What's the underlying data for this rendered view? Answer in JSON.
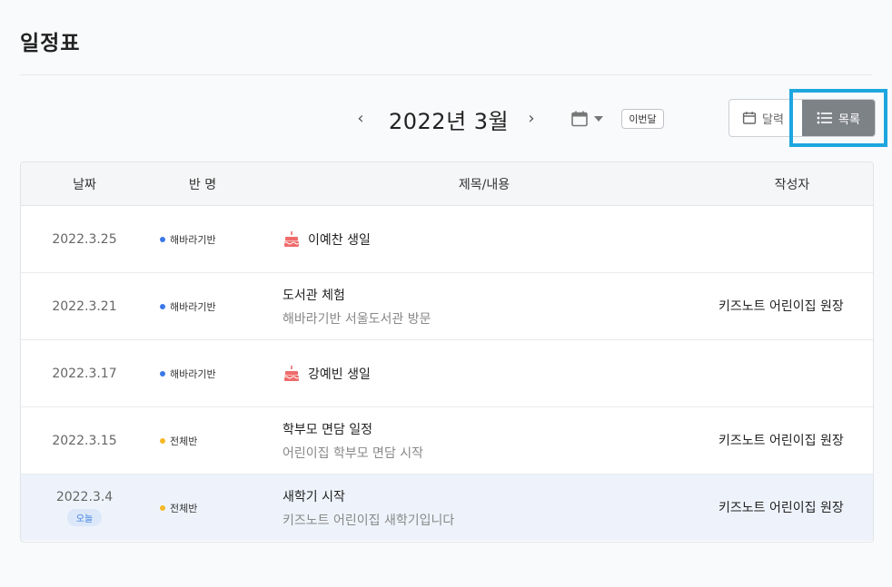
{
  "page": {
    "title": "일정표"
  },
  "nav": {
    "prev_glyph": "‹",
    "next_glyph": "›",
    "month": "2022년 3월",
    "this_month_label": "이번달",
    "icon": "calendar-icon"
  },
  "view_toggle": {
    "calendar_label": "달력",
    "list_label": "목록",
    "active": "list"
  },
  "table": {
    "headers": {
      "date": "날짜",
      "class": "반 명",
      "title": "제목/내용",
      "author": "작성자"
    },
    "rows": [
      {
        "date": "2022.3.25",
        "class": "해바라기반",
        "class_color": "#3b78e7",
        "title": "이예찬 생일",
        "desc": "",
        "author": "",
        "birthday": true
      },
      {
        "date": "2022.3.21",
        "class": "해바라기반",
        "class_color": "#3b78e7",
        "title": "도서관 체험",
        "desc": "해바라기반 서울도서관 방문",
        "author": "키즈노트 어린이집 원장",
        "birthday": false
      },
      {
        "date": "2022.3.17",
        "class": "해바라기반",
        "class_color": "#3b78e7",
        "title": "강예빈 생일",
        "desc": "",
        "author": "",
        "birthday": true
      },
      {
        "date": "2022.3.15",
        "class": "전체반",
        "class_color": "#f5b826",
        "title": "학부모 면담 일정",
        "desc": "어린이집 학부모 면담 시작",
        "author": "키즈노트 어린이집 원장",
        "birthday": false
      },
      {
        "date": "2022.3.4",
        "today_badge": "오늘",
        "class": "전체반",
        "class_color": "#f5b826",
        "title": "새학기 시작",
        "desc": "키즈노트 어린이집 새학기입니다",
        "author": "키즈노트 어린이집 원장",
        "birthday": false
      }
    ]
  },
  "colors": {
    "accent": "#1ea6df",
    "active_toggle": "#7d8287",
    "today_row": "#eef3fb",
    "cake": "#ef6b6b"
  }
}
